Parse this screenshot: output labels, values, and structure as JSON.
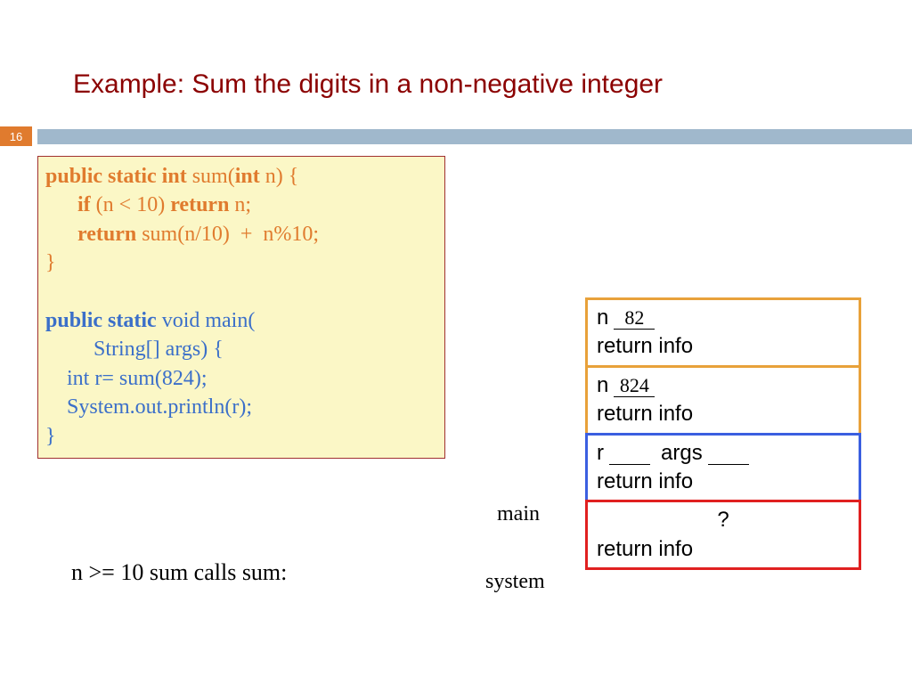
{
  "title": "Example: Sum the digits in a non-negative integer",
  "page_number": "16",
  "code": {
    "l1_kw": "public static int ",
    "l1_fn": "sum(",
    "l1_kw2": "int ",
    "l1_tail": "n) {",
    "l2_if": "if ",
    "l2_cond": "(n < 10) ",
    "l2_ret": "return ",
    "l2_tail": "n;",
    "l3_ret": "return ",
    "l3_tail": "sum(n/10)  +  n%10;",
    "l4": "}",
    "m1_kw": "public static ",
    "m1_tail": "void main(",
    "m2": "String[] args) {",
    "m3": "int r= sum(824);",
    "m4": "System.out.println(r);",
    "m5": "}"
  },
  "annotation": "n >= 10 sum calls sum:",
  "labels": {
    "main": "main",
    "system": "system"
  },
  "stack": {
    "f0": {
      "var": "n",
      "val": "82",
      "ret": "return info"
    },
    "f1": {
      "var": "n",
      "val": "824",
      "ret": "return info"
    },
    "f2": {
      "var1": "r",
      "var2": "args",
      "ret": "return info"
    },
    "f3": {
      "q": "?",
      "ret": "return info"
    }
  }
}
